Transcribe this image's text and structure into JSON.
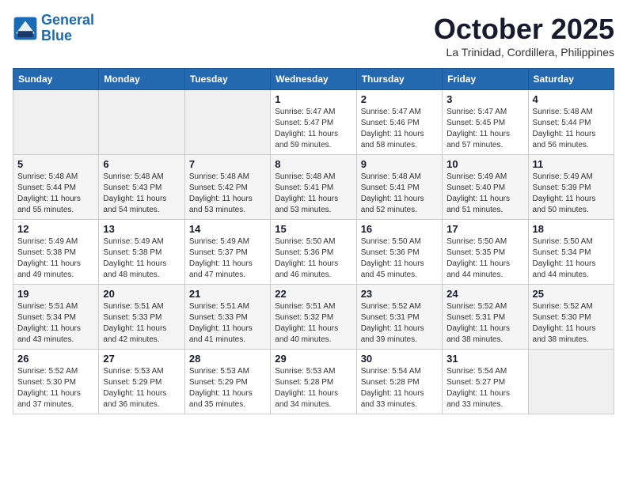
{
  "header": {
    "logo_line1": "General",
    "logo_line2": "Blue",
    "month": "October 2025",
    "location": "La Trinidad, Cordillera, Philippines"
  },
  "days_of_week": [
    "Sunday",
    "Monday",
    "Tuesday",
    "Wednesday",
    "Thursday",
    "Friday",
    "Saturday"
  ],
  "weeks": [
    [
      {
        "num": "",
        "sunrise": "",
        "sunset": "",
        "daylight": ""
      },
      {
        "num": "",
        "sunrise": "",
        "sunset": "",
        "daylight": ""
      },
      {
        "num": "",
        "sunrise": "",
        "sunset": "",
        "daylight": ""
      },
      {
        "num": "1",
        "sunrise": "Sunrise: 5:47 AM",
        "sunset": "Sunset: 5:47 PM",
        "daylight": "Daylight: 11 hours and 59 minutes."
      },
      {
        "num": "2",
        "sunrise": "Sunrise: 5:47 AM",
        "sunset": "Sunset: 5:46 PM",
        "daylight": "Daylight: 11 hours and 58 minutes."
      },
      {
        "num": "3",
        "sunrise": "Sunrise: 5:47 AM",
        "sunset": "Sunset: 5:45 PM",
        "daylight": "Daylight: 11 hours and 57 minutes."
      },
      {
        "num": "4",
        "sunrise": "Sunrise: 5:48 AM",
        "sunset": "Sunset: 5:44 PM",
        "daylight": "Daylight: 11 hours and 56 minutes."
      }
    ],
    [
      {
        "num": "5",
        "sunrise": "Sunrise: 5:48 AM",
        "sunset": "Sunset: 5:44 PM",
        "daylight": "Daylight: 11 hours and 55 minutes."
      },
      {
        "num": "6",
        "sunrise": "Sunrise: 5:48 AM",
        "sunset": "Sunset: 5:43 PM",
        "daylight": "Daylight: 11 hours and 54 minutes."
      },
      {
        "num": "7",
        "sunrise": "Sunrise: 5:48 AM",
        "sunset": "Sunset: 5:42 PM",
        "daylight": "Daylight: 11 hours and 53 minutes."
      },
      {
        "num": "8",
        "sunrise": "Sunrise: 5:48 AM",
        "sunset": "Sunset: 5:41 PM",
        "daylight": "Daylight: 11 hours and 53 minutes."
      },
      {
        "num": "9",
        "sunrise": "Sunrise: 5:48 AM",
        "sunset": "Sunset: 5:41 PM",
        "daylight": "Daylight: 11 hours and 52 minutes."
      },
      {
        "num": "10",
        "sunrise": "Sunrise: 5:49 AM",
        "sunset": "Sunset: 5:40 PM",
        "daylight": "Daylight: 11 hours and 51 minutes."
      },
      {
        "num": "11",
        "sunrise": "Sunrise: 5:49 AM",
        "sunset": "Sunset: 5:39 PM",
        "daylight": "Daylight: 11 hours and 50 minutes."
      }
    ],
    [
      {
        "num": "12",
        "sunrise": "Sunrise: 5:49 AM",
        "sunset": "Sunset: 5:38 PM",
        "daylight": "Daylight: 11 hours and 49 minutes."
      },
      {
        "num": "13",
        "sunrise": "Sunrise: 5:49 AM",
        "sunset": "Sunset: 5:38 PM",
        "daylight": "Daylight: 11 hours and 48 minutes."
      },
      {
        "num": "14",
        "sunrise": "Sunrise: 5:49 AM",
        "sunset": "Sunset: 5:37 PM",
        "daylight": "Daylight: 11 hours and 47 minutes."
      },
      {
        "num": "15",
        "sunrise": "Sunrise: 5:50 AM",
        "sunset": "Sunset: 5:36 PM",
        "daylight": "Daylight: 11 hours and 46 minutes."
      },
      {
        "num": "16",
        "sunrise": "Sunrise: 5:50 AM",
        "sunset": "Sunset: 5:36 PM",
        "daylight": "Daylight: 11 hours and 45 minutes."
      },
      {
        "num": "17",
        "sunrise": "Sunrise: 5:50 AM",
        "sunset": "Sunset: 5:35 PM",
        "daylight": "Daylight: 11 hours and 44 minutes."
      },
      {
        "num": "18",
        "sunrise": "Sunrise: 5:50 AM",
        "sunset": "Sunset: 5:34 PM",
        "daylight": "Daylight: 11 hours and 44 minutes."
      }
    ],
    [
      {
        "num": "19",
        "sunrise": "Sunrise: 5:51 AM",
        "sunset": "Sunset: 5:34 PM",
        "daylight": "Daylight: 11 hours and 43 minutes."
      },
      {
        "num": "20",
        "sunrise": "Sunrise: 5:51 AM",
        "sunset": "Sunset: 5:33 PM",
        "daylight": "Daylight: 11 hours and 42 minutes."
      },
      {
        "num": "21",
        "sunrise": "Sunrise: 5:51 AM",
        "sunset": "Sunset: 5:33 PM",
        "daylight": "Daylight: 11 hours and 41 minutes."
      },
      {
        "num": "22",
        "sunrise": "Sunrise: 5:51 AM",
        "sunset": "Sunset: 5:32 PM",
        "daylight": "Daylight: 11 hours and 40 minutes."
      },
      {
        "num": "23",
        "sunrise": "Sunrise: 5:52 AM",
        "sunset": "Sunset: 5:31 PM",
        "daylight": "Daylight: 11 hours and 39 minutes."
      },
      {
        "num": "24",
        "sunrise": "Sunrise: 5:52 AM",
        "sunset": "Sunset: 5:31 PM",
        "daylight": "Daylight: 11 hours and 38 minutes."
      },
      {
        "num": "25",
        "sunrise": "Sunrise: 5:52 AM",
        "sunset": "Sunset: 5:30 PM",
        "daylight": "Daylight: 11 hours and 38 minutes."
      }
    ],
    [
      {
        "num": "26",
        "sunrise": "Sunrise: 5:52 AM",
        "sunset": "Sunset: 5:30 PM",
        "daylight": "Daylight: 11 hours and 37 minutes."
      },
      {
        "num": "27",
        "sunrise": "Sunrise: 5:53 AM",
        "sunset": "Sunset: 5:29 PM",
        "daylight": "Daylight: 11 hours and 36 minutes."
      },
      {
        "num": "28",
        "sunrise": "Sunrise: 5:53 AM",
        "sunset": "Sunset: 5:29 PM",
        "daylight": "Daylight: 11 hours and 35 minutes."
      },
      {
        "num": "29",
        "sunrise": "Sunrise: 5:53 AM",
        "sunset": "Sunset: 5:28 PM",
        "daylight": "Daylight: 11 hours and 34 minutes."
      },
      {
        "num": "30",
        "sunrise": "Sunrise: 5:54 AM",
        "sunset": "Sunset: 5:28 PM",
        "daylight": "Daylight: 11 hours and 33 minutes."
      },
      {
        "num": "31",
        "sunrise": "Sunrise: 5:54 AM",
        "sunset": "Sunset: 5:27 PM",
        "daylight": "Daylight: 11 hours and 33 minutes."
      },
      {
        "num": "",
        "sunrise": "",
        "sunset": "",
        "daylight": ""
      }
    ]
  ]
}
